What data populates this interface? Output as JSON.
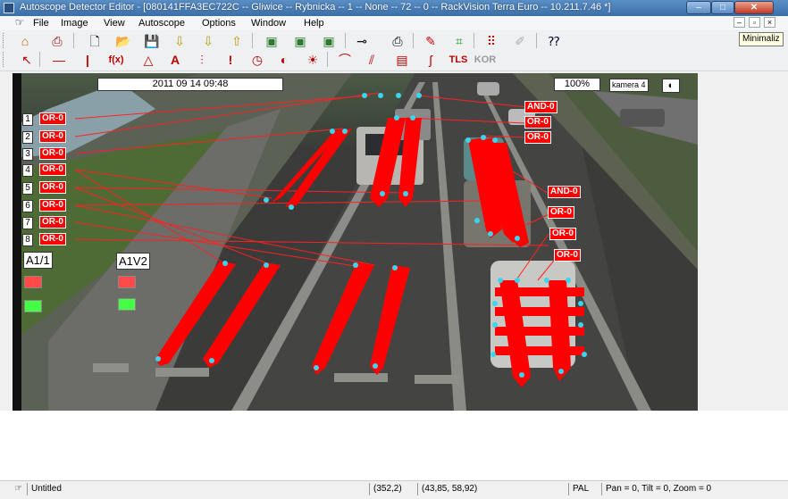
{
  "window": {
    "title": "Autoscope Detector Editor - [080141FFA3EC722C -- Gliwice -- Rybnicka -- 1 -- None -- 72 -- 0 -- RackVision Terra Euro -- 10.211.7.46 *]",
    "min_glyph": "–",
    "max_glyph": "□",
    "close_glyph": "✕"
  },
  "menu": {
    "items": [
      "File",
      "Image",
      "View",
      "Autoscope",
      "Options",
      "Window",
      "Help"
    ],
    "mdi_min": "–",
    "mdi_restore": "▫",
    "mdi_close": "×"
  },
  "tooltip": "Minimaliz",
  "toolbar1": {
    "icons": [
      "home-icon",
      "camera-icon",
      "new-file-icon",
      "open-folder-icon",
      "save-icon",
      "download-icon",
      "upload-icon",
      "upload-alt-icon",
      "image-window-icon",
      "image-save-icon",
      "image-export-icon",
      "probe-icon",
      "print-icon",
      "pencil-icon",
      "grid-icon",
      "dots-icon",
      "disabled-edit-icon",
      "help-icon"
    ],
    "glyphs": [
      "⌂",
      "⎙",
      "🗋",
      "📂",
      "💾",
      "⇩",
      "⇩",
      "⇧",
      "▣",
      "▣",
      "▣",
      "⊸",
      "⎙",
      "✎",
      "⌗",
      "⠿",
      "✐",
      "⁇"
    ]
  },
  "toolbar2": {
    "icons": [
      "pointer-icon",
      "horizontal-line-icon",
      "vertical-line-icon",
      "function-icon",
      "triangle-icon",
      "text-a-icon",
      "bars-icon",
      "exclamation-icon",
      "clock-icon",
      "halfcircle-icon",
      "sun-icon",
      "rainbow-icon",
      "stripes-icon",
      "label-icon",
      "pipe-icon"
    ],
    "glyphs": [
      "↖",
      "—",
      "|",
      "f(x)",
      "△",
      "A",
      "⫶",
      "!",
      "◷",
      "◐",
      "☀",
      "⌒",
      "⫽",
      "▤",
      "ʃ"
    ],
    "tls": "TLS",
    "kor": "KOR"
  },
  "video": {
    "timestamp": "2011 09 14 09:48",
    "zoom": "100%",
    "camera": "kamera 4",
    "camera_icon": "◐",
    "detector_numbers": [
      "1",
      "2",
      "3",
      "4",
      "5",
      "6",
      "7",
      "8"
    ],
    "or_labels": [
      "OR-0",
      "OR-0",
      "OR-0",
      "OR-0",
      "OR-0",
      "OR-0",
      "OR-0",
      "OR-0"
    ],
    "right_labels": [
      "AND-0",
      "OR-0",
      "OR-0",
      "AND-0",
      "OR-0",
      "OR-0",
      "OR-0"
    ],
    "groups": [
      "A1/1",
      "A1V2"
    ],
    "indicator_colors": {
      "red": "#ff4a4a",
      "green": "#44ff44"
    },
    "detector_color": "#ff0000",
    "handle_color": "#3ad6f0"
  },
  "status": {
    "doc": "Untitled",
    "pixel": "(352,2)",
    "coords": "(43,85, 58,92)",
    "format": "PAL",
    "ptz": "Pan = 0, Tilt = 0, Zoom = 0"
  }
}
